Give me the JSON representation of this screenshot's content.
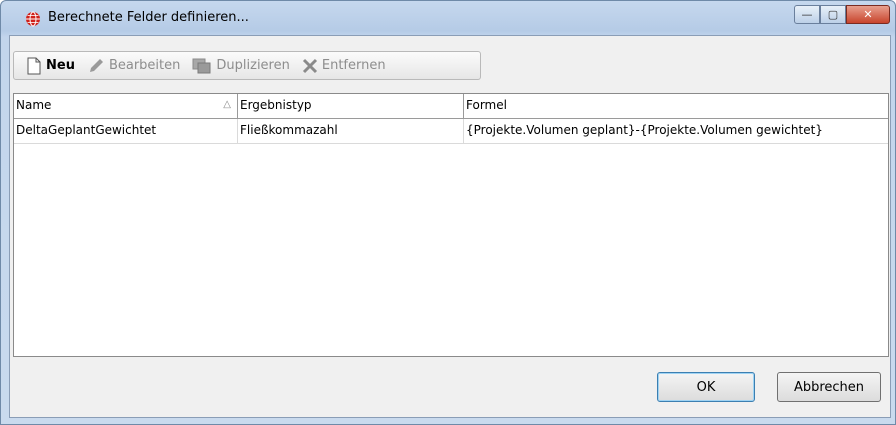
{
  "window": {
    "title": "Berechnete Felder definieren...",
    "caption": {
      "minimize": "—",
      "maximize": "▢",
      "close": "✕"
    }
  },
  "toolbar": {
    "new_label": "Neu",
    "edit_label": "Bearbeiten",
    "duplicate_label": "Duplizieren",
    "remove_label": "Entfernen"
  },
  "table": {
    "columns": [
      "Name",
      "Ergebnistyp",
      "Formel"
    ],
    "sort_indicator": "△",
    "rows": [
      [
        "DeltaGeplantGewichtet",
        "Fließkommazahl",
        "{Projekte.Volumen geplant}-{Projekte.Volumen gewichtet}"
      ]
    ]
  },
  "buttons": {
    "ok_label": "OK",
    "cancel_label": "Abbrechen"
  },
  "colors": {
    "app_icon": "#d0211a",
    "close_button": "#c8442c"
  }
}
